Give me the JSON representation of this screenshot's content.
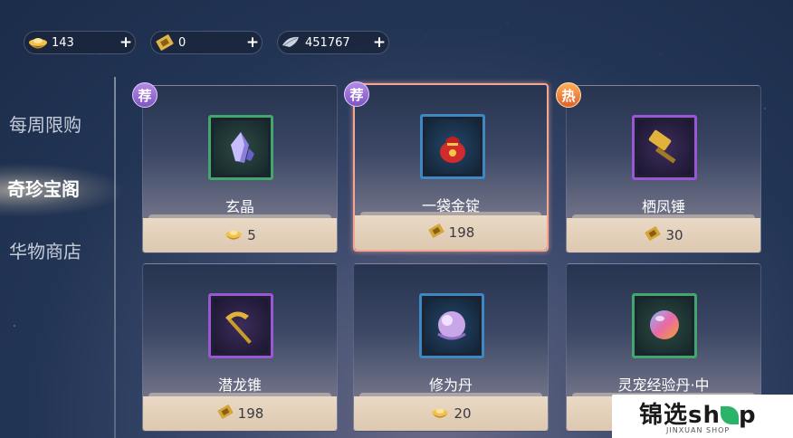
{
  "currencies": [
    {
      "icon": "gold-ingot-icon",
      "value": "143"
    },
    {
      "icon": "ticket-icon",
      "value": "0"
    },
    {
      "icon": "silver-feather-icon",
      "value": "451767"
    }
  ],
  "sidebar": {
    "items": [
      {
        "label": "每周限购",
        "active": false
      },
      {
        "label": "奇珍宝阁",
        "active": true
      },
      {
        "label": "华物商店",
        "active": false
      }
    ]
  },
  "shop": {
    "items": [
      {
        "name": "玄晶",
        "price": "5",
        "price_icon": "gold-ingot-icon",
        "badge": "荐",
        "rarity": "green",
        "icon": "crystal-icon",
        "selected": false
      },
      {
        "name": "一袋金锭",
        "price": "198",
        "price_icon": "ticket-icon",
        "badge": "荐",
        "rarity": "blue",
        "icon": "money-bag-icon",
        "selected": true
      },
      {
        "name": "栖凤锤",
        "price": "30",
        "price_icon": "ticket-icon",
        "badge": "热",
        "rarity": "purple",
        "icon": "hammer-icon",
        "selected": false
      },
      {
        "name": "潜龙锥",
        "price": "198",
        "price_icon": "ticket-icon",
        "badge": "",
        "rarity": "purple",
        "icon": "pickaxe-icon",
        "selected": false
      },
      {
        "name": "修为丹",
        "price": "20",
        "price_icon": "gold-ingot-icon",
        "badge": "",
        "rarity": "blue",
        "icon": "orb-icon",
        "selected": false
      },
      {
        "name": "灵宠经验丹·中",
        "price": "",
        "price_icon": "",
        "badge": "",
        "rarity": "green",
        "icon": "pearl-icon",
        "selected": false
      }
    ]
  },
  "watermark": {
    "main_a": "锦选sh",
    "main_b": "p",
    "small": "JINXUAN SHOP"
  },
  "colors": {
    "selected_border": "#f2a794",
    "rare_green": "#3fa86a",
    "rare_blue": "#3c88c2",
    "rare_purple": "#9a56d6"
  }
}
